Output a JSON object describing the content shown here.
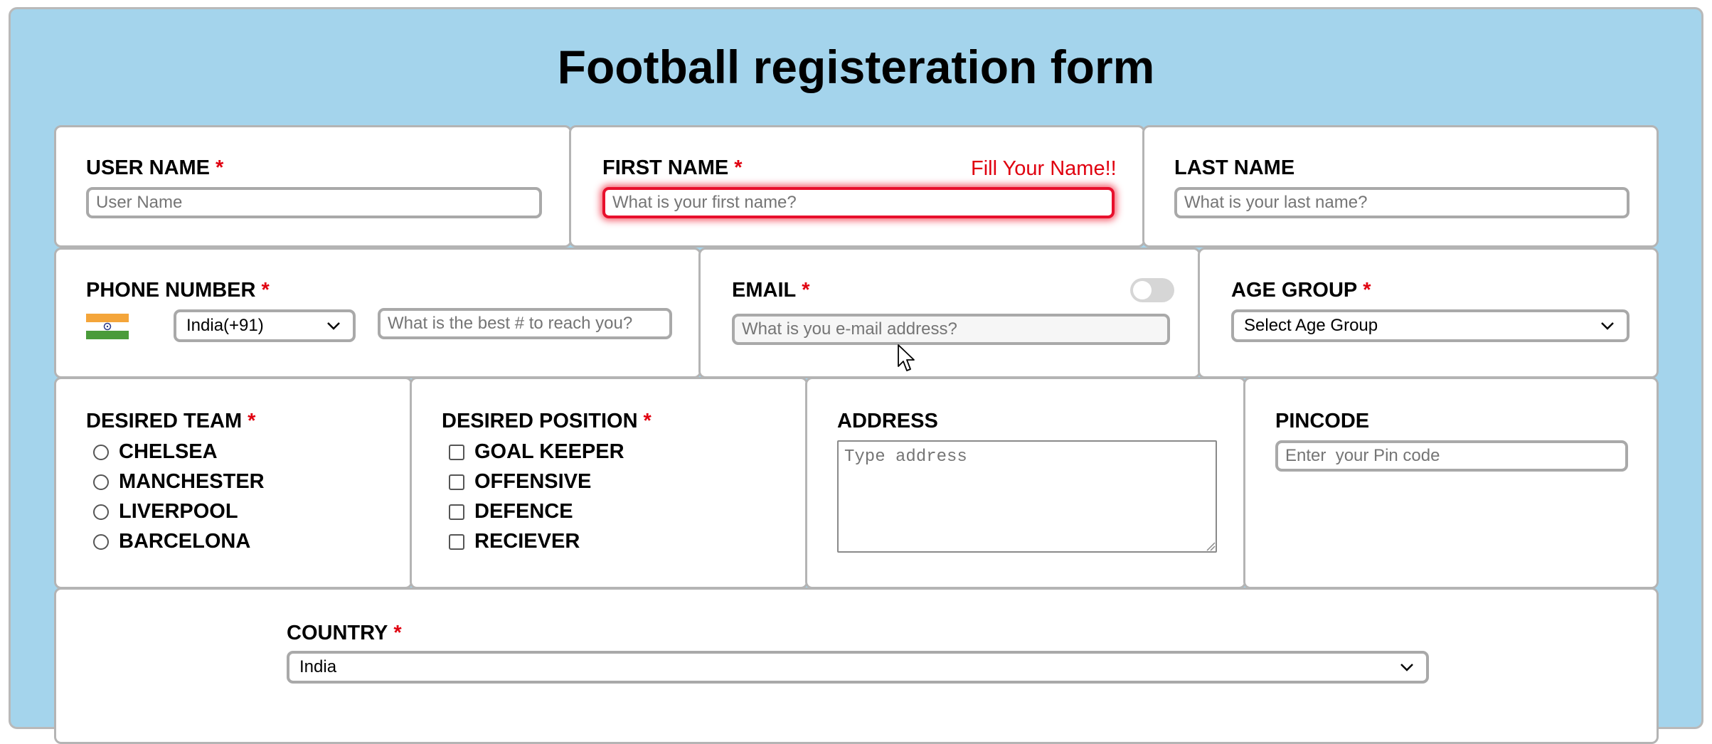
{
  "title": "Football registeration form",
  "required_mark": "*",
  "username": {
    "label": "USER NAME",
    "placeholder": "User Name"
  },
  "firstname": {
    "label": "FIRST NAME",
    "error": "Fill Your Name!!",
    "placeholder": "What is your first name?"
  },
  "lastname": {
    "label": "LAST NAME",
    "placeholder": "What is your last name?"
  },
  "phone": {
    "label": "PHONE NUMBER",
    "country_code": "India(+91)",
    "placeholder": "What is the best # to reach you?",
    "flag_icon": "india-flag-icon"
  },
  "email": {
    "label": "EMAIL",
    "placeholder": "What is you e-mail address?",
    "toggle_on": false
  },
  "age_group": {
    "label": "AGE GROUP",
    "selected": "Select Age Group"
  },
  "desired_team": {
    "label": "DESIRED TEAM",
    "options": [
      "CHELSEA",
      "MANCHESTER",
      "LIVERPOOL",
      "BARCELONA"
    ]
  },
  "desired_position": {
    "label": "DESIRED POSITION",
    "options": [
      "GOAL KEEPER",
      "OFFENSIVE",
      "DEFENCE",
      "RECIEVER"
    ]
  },
  "address": {
    "label": "ADDRESS",
    "placeholder": "Type address"
  },
  "pincode": {
    "label": "PINCODE",
    "placeholder": "Enter  your Pin code"
  },
  "country": {
    "label": "COUNTRY",
    "selected": "India"
  },
  "colors": {
    "background": "#a4d4ec",
    "required": "#e0000f",
    "error_glow": "#f0283c"
  }
}
